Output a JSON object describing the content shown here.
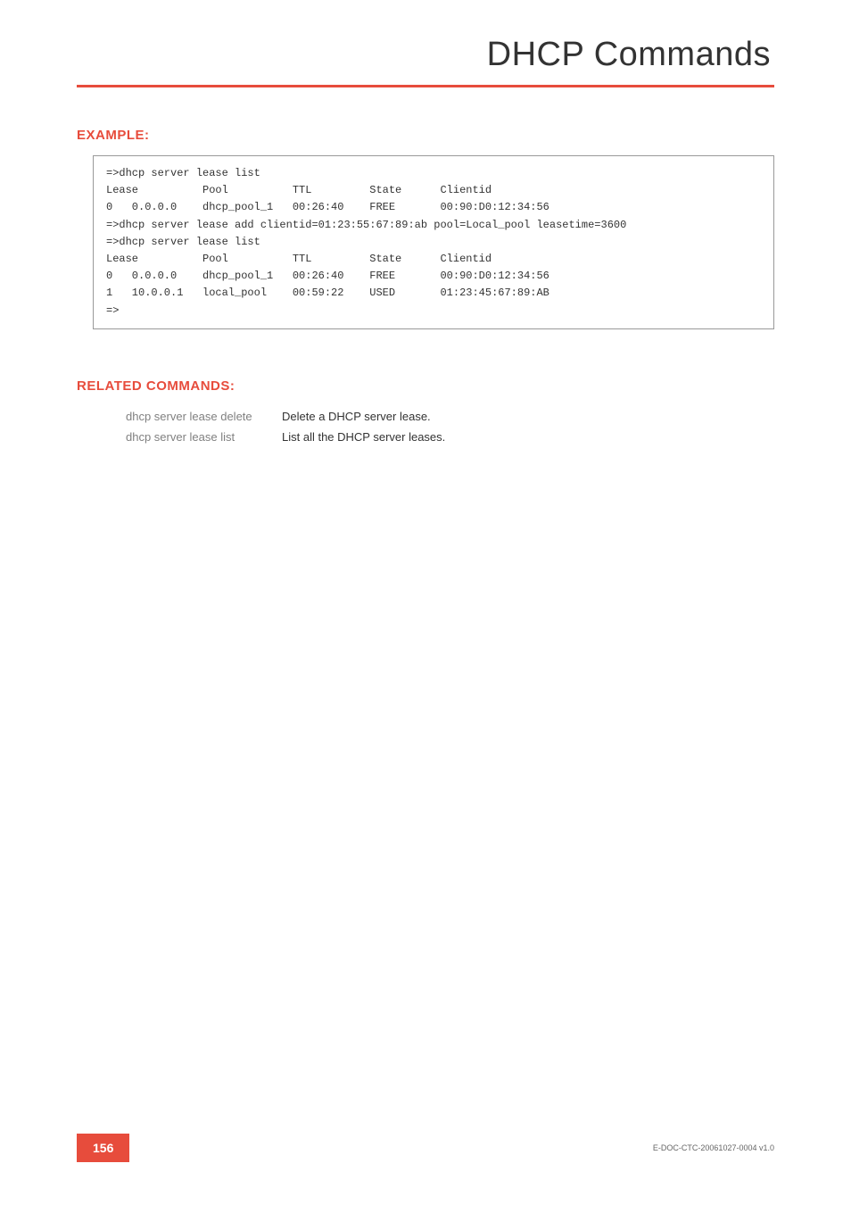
{
  "header": {
    "title": "DHCP Commands"
  },
  "sections": {
    "example": {
      "heading": "EXAMPLE:",
      "code": "=>dhcp server lease list\nLease          Pool          TTL         State      Clientid\n0   0.0.0.0    dhcp_pool_1   00:26:40    FREE       00:90:D0:12:34:56\n=>dhcp server lease add clientid=01:23:55:67:89:ab pool=Local_pool leasetime=3600\n=>dhcp server lease list\nLease          Pool          TTL         State      Clientid\n0   0.0.0.0    dhcp_pool_1   00:26:40    FREE       00:90:D0:12:34:56\n1   10.0.0.1   local_pool    00:59:22    USED       01:23:45:67:89:AB\n=>"
    },
    "related": {
      "heading": "RELATED COMMANDS:",
      "rows": [
        {
          "cmd": "dhcp server lease delete",
          "desc": "Delete a DHCP server lease."
        },
        {
          "cmd": "dhcp server lease list",
          "desc": "List all the DHCP server leases."
        }
      ]
    }
  },
  "footer": {
    "page_number": "156",
    "doc_id": "E-DOC-CTC-20061027-0004 v1.0"
  }
}
